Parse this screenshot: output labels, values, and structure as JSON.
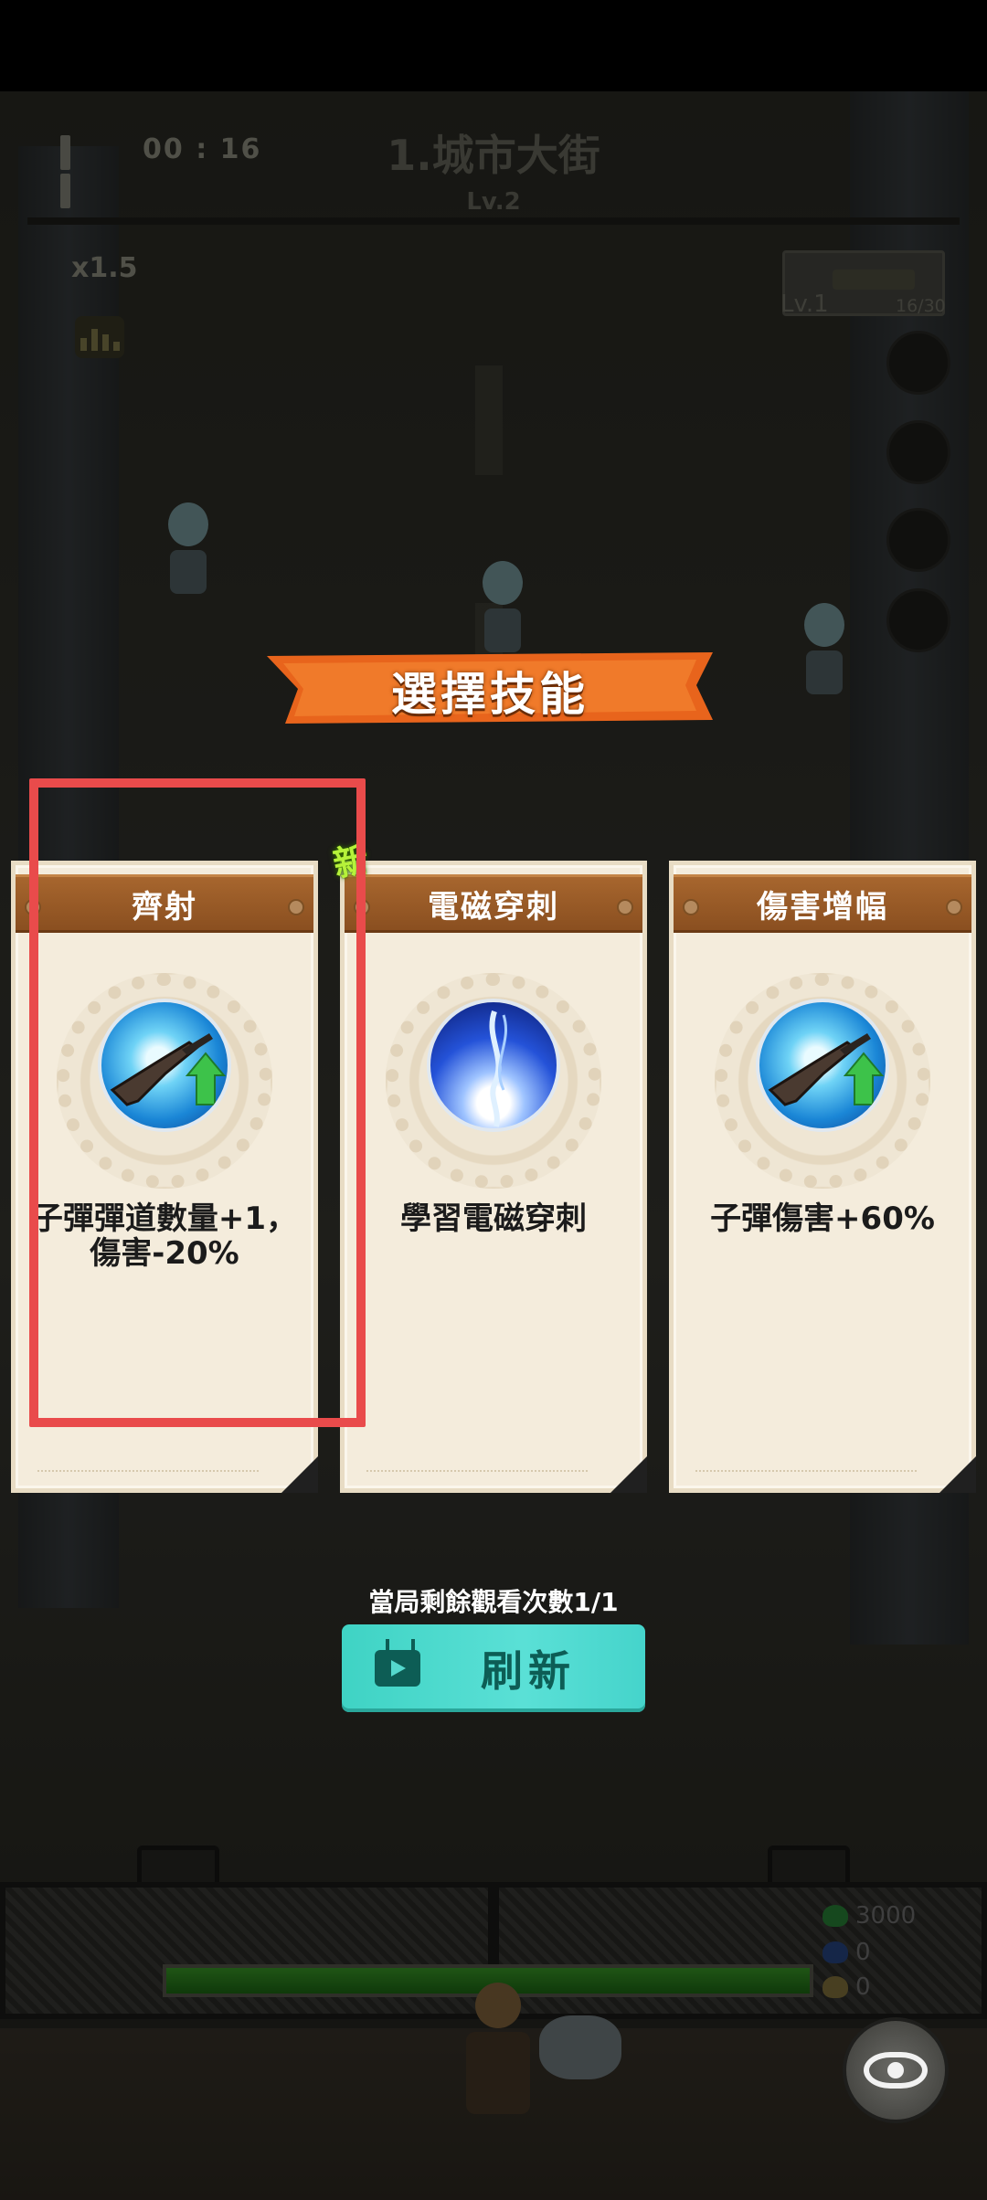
{
  "hud": {
    "timer": "00 : 16",
    "stage_title": "1.城市大街",
    "stage_level": "Lv.2",
    "speed": "x1.5",
    "weapon_level": "Lv.1",
    "weapon_ammo": "16/30"
  },
  "skill_select": {
    "title": "選擇技能",
    "new_badge": "新",
    "cards": [
      {
        "name": "齊射",
        "icon": "rifle-upgrade-icon",
        "desc": "子彈彈道數量+1，傷害-20%",
        "highlighted": true
      },
      {
        "name": "電磁穿刺",
        "icon": "electromagnetic-icon",
        "desc": "學習電磁穿刺",
        "is_new": true
      },
      {
        "name": "傷害增幅",
        "icon": "rifle-upgrade-icon",
        "desc": "子彈傷害+60%"
      }
    ],
    "remaining_views": "當局剩餘觀看次數1/1",
    "refresh_label": "刷新"
  },
  "resources": {
    "hp": "3000",
    "shield": "0",
    "coins": "0"
  },
  "colors": {
    "banner_orange": "#e8641c",
    "refresh_teal": "#4fdccf",
    "highlight_red": "#e94b4b",
    "card_bg": "#f4ecdc",
    "header_brown": "#9a5a26"
  }
}
